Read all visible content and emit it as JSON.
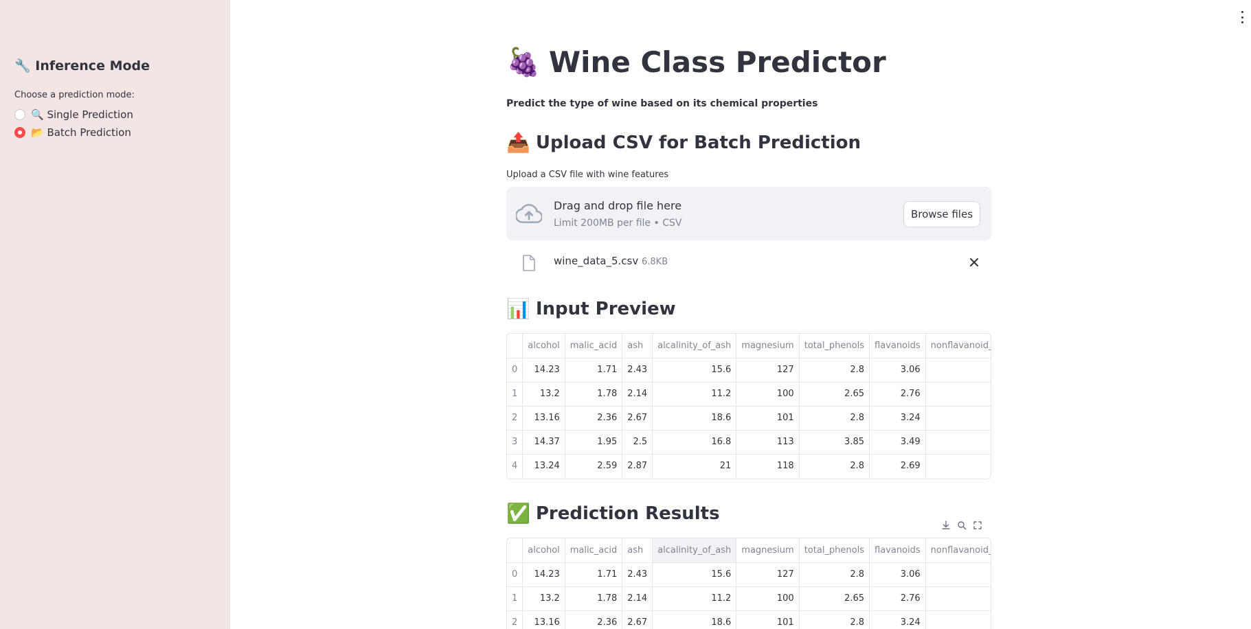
{
  "sidebar": {
    "title": "🔧 Inference Mode",
    "caption": "Choose a prediction mode:",
    "options": [
      {
        "label": "🔍 Single Prediction",
        "selected": false
      },
      {
        "label": "📂 Batch Prediction",
        "selected": true
      }
    ],
    "background": "#f3e5e3",
    "accent": "#ff4b4b"
  },
  "header": {
    "emoji": "🍇",
    "title": "Wine Class Predictor",
    "subtitle": "Predict the type of wine based on its chemical properties"
  },
  "upload": {
    "heading_emoji": "📤",
    "heading": "Upload CSV for Batch Prediction",
    "caption": "Upload a CSV file with wine features",
    "dropzone_title": "Drag and drop file here",
    "dropzone_limit": "Limit 200MB per file • CSV",
    "browse_label": "Browse files",
    "file": {
      "name": "wine_data_5.csv",
      "size": "6.8KB"
    }
  },
  "preview": {
    "heading_emoji": "📊",
    "heading": "Input Preview",
    "columns": [
      "",
      "alcohol",
      "malic_acid",
      "ash",
      "alcalinity_of_ash",
      "magnesium",
      "total_phenols",
      "flavanoids",
      "nonflavanoid_"
    ],
    "rows": [
      [
        "0",
        "14.23",
        "1.71",
        "2.43",
        "15.6",
        "127",
        "2.8",
        "3.06",
        ""
      ],
      [
        "1",
        "13.2",
        "1.78",
        "2.14",
        "11.2",
        "100",
        "2.65",
        "2.76",
        ""
      ],
      [
        "2",
        "13.16",
        "2.36",
        "2.67",
        "18.6",
        "101",
        "2.8",
        "3.24",
        ""
      ],
      [
        "3",
        "14.37",
        "1.95",
        "2.5",
        "16.8",
        "113",
        "3.85",
        "3.49",
        ""
      ],
      [
        "4",
        "13.24",
        "2.59",
        "2.87",
        "21",
        "118",
        "2.8",
        "2.69",
        ""
      ]
    ]
  },
  "results": {
    "heading_emoji": "✅",
    "heading": "Prediction Results",
    "toolbar_icons": [
      "download-icon",
      "search-icon",
      "fullscreen-icon"
    ],
    "columns": [
      "",
      "alcohol",
      "malic_acid",
      "ash",
      "alcalinity_of_ash",
      "magnesium",
      "total_phenols",
      "flavanoids",
      "nonflavanoid_"
    ],
    "rows": [
      [
        "0",
        "14.23",
        "1.71",
        "2.43",
        "15.6",
        "127",
        "2.8",
        "3.06",
        ""
      ],
      [
        "1",
        "13.2",
        "1.78",
        "2.14",
        "11.2",
        "100",
        "2.65",
        "2.76",
        ""
      ],
      [
        "2",
        "13.16",
        "2.36",
        "2.67",
        "18.6",
        "101",
        "2.8",
        "3.24",
        ""
      ]
    ]
  }
}
